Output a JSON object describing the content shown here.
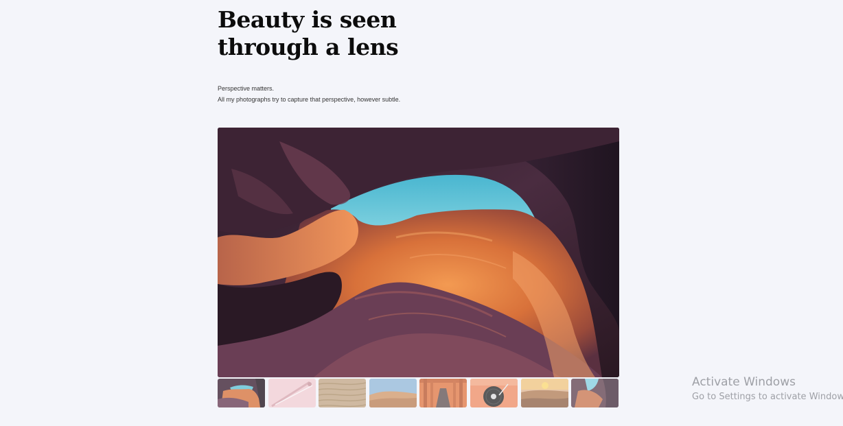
{
  "header": {
    "title_line1": "Beauty is seen",
    "title_line2": "through a lens"
  },
  "intro": {
    "line1": "Perspective matters.",
    "line2": "All my photographs try to capture that perspective, however subtle."
  },
  "gallery": {
    "hero_image": "antelope-canyon-photo",
    "active_index": 0,
    "thumbnails": [
      {
        "subject": "antelope-canyon-thumbnail"
      },
      {
        "subject": "pink-eyelash-curler-thumbnail"
      },
      {
        "subject": "sand-ripples-thumbnail"
      },
      {
        "subject": "desert-dunes-blue-sky-thumbnail"
      },
      {
        "subject": "orange-torii-gates-thumbnail"
      },
      {
        "subject": "turntable-record-thumbnail"
      },
      {
        "subject": "desert-sunset-thumbnail"
      },
      {
        "subject": "canyon-rock-thumbnail"
      }
    ]
  },
  "watermark": {
    "title": "Activate Windows",
    "subtitle": "Go to Settings to activate Windows."
  },
  "colors": {
    "background": "#f4f5fa",
    "heading": "#0c0c0c",
    "canyon_orange": "#e2793a",
    "canyon_purple": "#4a2a3e",
    "sky_blue": "#5fc2d6",
    "watermark": "#9ea0a6"
  }
}
